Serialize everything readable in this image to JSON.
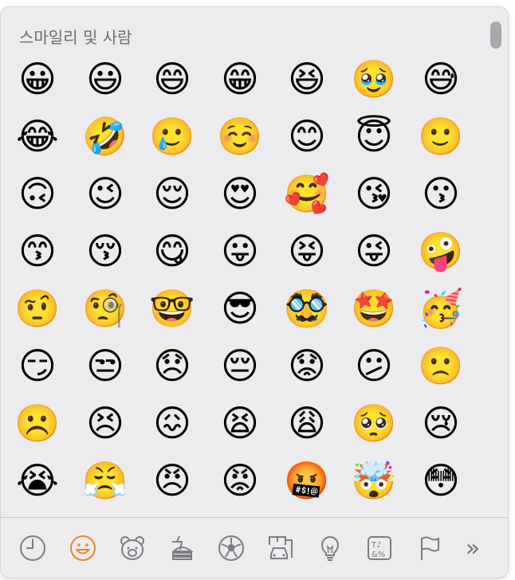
{
  "section_title": "스마일리 및 사람",
  "accent_color": "#e8862a",
  "icon_color": "#7d7c80",
  "emoji_rows": [
    [
      "😀",
      "😃",
      "😄",
      "😁",
      "😆",
      "🥹",
      "😅"
    ],
    [
      "😂",
      "🤣",
      "🥲",
      "☺️",
      "😊",
      "😇",
      "🙂"
    ],
    [
      "🙃",
      "😉",
      "😌",
      "😍",
      "🥰",
      "😘",
      "😗"
    ],
    [
      "😙",
      "😚",
      "😋",
      "😛",
      "😝",
      "😜",
      "🤪"
    ],
    [
      "🤨",
      "🧐",
      "🤓",
      "😎",
      "🥸",
      "🤩",
      "🥳"
    ],
    [
      "😏",
      "😒",
      "😞",
      "😔",
      "😟",
      "😕",
      "🙁"
    ],
    [
      "☹️",
      "😣",
      "😖",
      "😫",
      "😩",
      "🥺",
      "😢"
    ],
    [
      "😭",
      "😤",
      "😠",
      "😡",
      "🤬",
      "🤯",
      "😳"
    ]
  ],
  "categories": [
    {
      "name": "recent-icon",
      "selected": false
    },
    {
      "name": "smileys-icon",
      "selected": true
    },
    {
      "name": "animals-icon",
      "selected": false
    },
    {
      "name": "food-icon",
      "selected": false
    },
    {
      "name": "activity-icon",
      "selected": false
    },
    {
      "name": "travel-icon",
      "selected": false
    },
    {
      "name": "objects-icon",
      "selected": false
    },
    {
      "name": "symbols-icon",
      "selected": false
    },
    {
      "name": "flags-icon",
      "selected": false
    }
  ],
  "more_label": "»"
}
